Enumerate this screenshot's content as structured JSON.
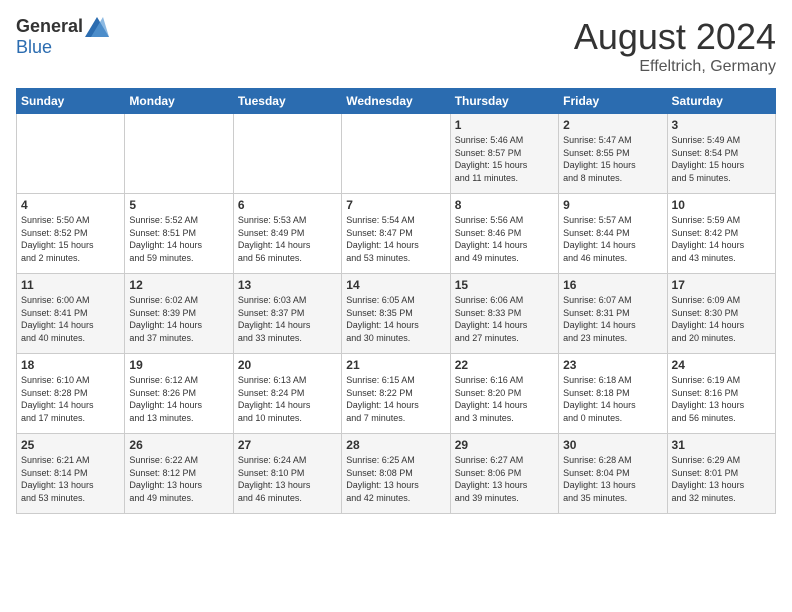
{
  "header": {
    "logo_general": "General",
    "logo_blue": "Blue",
    "month_year": "August 2024",
    "location": "Effeltrich, Germany"
  },
  "weekdays": [
    "Sunday",
    "Monday",
    "Tuesday",
    "Wednesday",
    "Thursday",
    "Friday",
    "Saturday"
  ],
  "weeks": [
    [
      {
        "day": "",
        "info": ""
      },
      {
        "day": "",
        "info": ""
      },
      {
        "day": "",
        "info": ""
      },
      {
        "day": "",
        "info": ""
      },
      {
        "day": "1",
        "info": "Sunrise: 5:46 AM\nSunset: 8:57 PM\nDaylight: 15 hours\nand 11 minutes."
      },
      {
        "day": "2",
        "info": "Sunrise: 5:47 AM\nSunset: 8:55 PM\nDaylight: 15 hours\nand 8 minutes."
      },
      {
        "day": "3",
        "info": "Sunrise: 5:49 AM\nSunset: 8:54 PM\nDaylight: 15 hours\nand 5 minutes."
      }
    ],
    [
      {
        "day": "4",
        "info": "Sunrise: 5:50 AM\nSunset: 8:52 PM\nDaylight: 15 hours\nand 2 minutes."
      },
      {
        "day": "5",
        "info": "Sunrise: 5:52 AM\nSunset: 8:51 PM\nDaylight: 14 hours\nand 59 minutes."
      },
      {
        "day": "6",
        "info": "Sunrise: 5:53 AM\nSunset: 8:49 PM\nDaylight: 14 hours\nand 56 minutes."
      },
      {
        "day": "7",
        "info": "Sunrise: 5:54 AM\nSunset: 8:47 PM\nDaylight: 14 hours\nand 53 minutes."
      },
      {
        "day": "8",
        "info": "Sunrise: 5:56 AM\nSunset: 8:46 PM\nDaylight: 14 hours\nand 49 minutes."
      },
      {
        "day": "9",
        "info": "Sunrise: 5:57 AM\nSunset: 8:44 PM\nDaylight: 14 hours\nand 46 minutes."
      },
      {
        "day": "10",
        "info": "Sunrise: 5:59 AM\nSunset: 8:42 PM\nDaylight: 14 hours\nand 43 minutes."
      }
    ],
    [
      {
        "day": "11",
        "info": "Sunrise: 6:00 AM\nSunset: 8:41 PM\nDaylight: 14 hours\nand 40 minutes."
      },
      {
        "day": "12",
        "info": "Sunrise: 6:02 AM\nSunset: 8:39 PM\nDaylight: 14 hours\nand 37 minutes."
      },
      {
        "day": "13",
        "info": "Sunrise: 6:03 AM\nSunset: 8:37 PM\nDaylight: 14 hours\nand 33 minutes."
      },
      {
        "day": "14",
        "info": "Sunrise: 6:05 AM\nSunset: 8:35 PM\nDaylight: 14 hours\nand 30 minutes."
      },
      {
        "day": "15",
        "info": "Sunrise: 6:06 AM\nSunset: 8:33 PM\nDaylight: 14 hours\nand 27 minutes."
      },
      {
        "day": "16",
        "info": "Sunrise: 6:07 AM\nSunset: 8:31 PM\nDaylight: 14 hours\nand 23 minutes."
      },
      {
        "day": "17",
        "info": "Sunrise: 6:09 AM\nSunset: 8:30 PM\nDaylight: 14 hours\nand 20 minutes."
      }
    ],
    [
      {
        "day": "18",
        "info": "Sunrise: 6:10 AM\nSunset: 8:28 PM\nDaylight: 14 hours\nand 17 minutes."
      },
      {
        "day": "19",
        "info": "Sunrise: 6:12 AM\nSunset: 8:26 PM\nDaylight: 14 hours\nand 13 minutes."
      },
      {
        "day": "20",
        "info": "Sunrise: 6:13 AM\nSunset: 8:24 PM\nDaylight: 14 hours\nand 10 minutes."
      },
      {
        "day": "21",
        "info": "Sunrise: 6:15 AM\nSunset: 8:22 PM\nDaylight: 14 hours\nand 7 minutes."
      },
      {
        "day": "22",
        "info": "Sunrise: 6:16 AM\nSunset: 8:20 PM\nDaylight: 14 hours\nand 3 minutes."
      },
      {
        "day": "23",
        "info": "Sunrise: 6:18 AM\nSunset: 8:18 PM\nDaylight: 14 hours\nand 0 minutes."
      },
      {
        "day": "24",
        "info": "Sunrise: 6:19 AM\nSunset: 8:16 PM\nDaylight: 13 hours\nand 56 minutes."
      }
    ],
    [
      {
        "day": "25",
        "info": "Sunrise: 6:21 AM\nSunset: 8:14 PM\nDaylight: 13 hours\nand 53 minutes."
      },
      {
        "day": "26",
        "info": "Sunrise: 6:22 AM\nSunset: 8:12 PM\nDaylight: 13 hours\nand 49 minutes."
      },
      {
        "day": "27",
        "info": "Sunrise: 6:24 AM\nSunset: 8:10 PM\nDaylight: 13 hours\nand 46 minutes."
      },
      {
        "day": "28",
        "info": "Sunrise: 6:25 AM\nSunset: 8:08 PM\nDaylight: 13 hours\nand 42 minutes."
      },
      {
        "day": "29",
        "info": "Sunrise: 6:27 AM\nSunset: 8:06 PM\nDaylight: 13 hours\nand 39 minutes."
      },
      {
        "day": "30",
        "info": "Sunrise: 6:28 AM\nSunset: 8:04 PM\nDaylight: 13 hours\nand 35 minutes."
      },
      {
        "day": "31",
        "info": "Sunrise: 6:29 AM\nSunset: 8:01 PM\nDaylight: 13 hours\nand 32 minutes."
      }
    ]
  ]
}
